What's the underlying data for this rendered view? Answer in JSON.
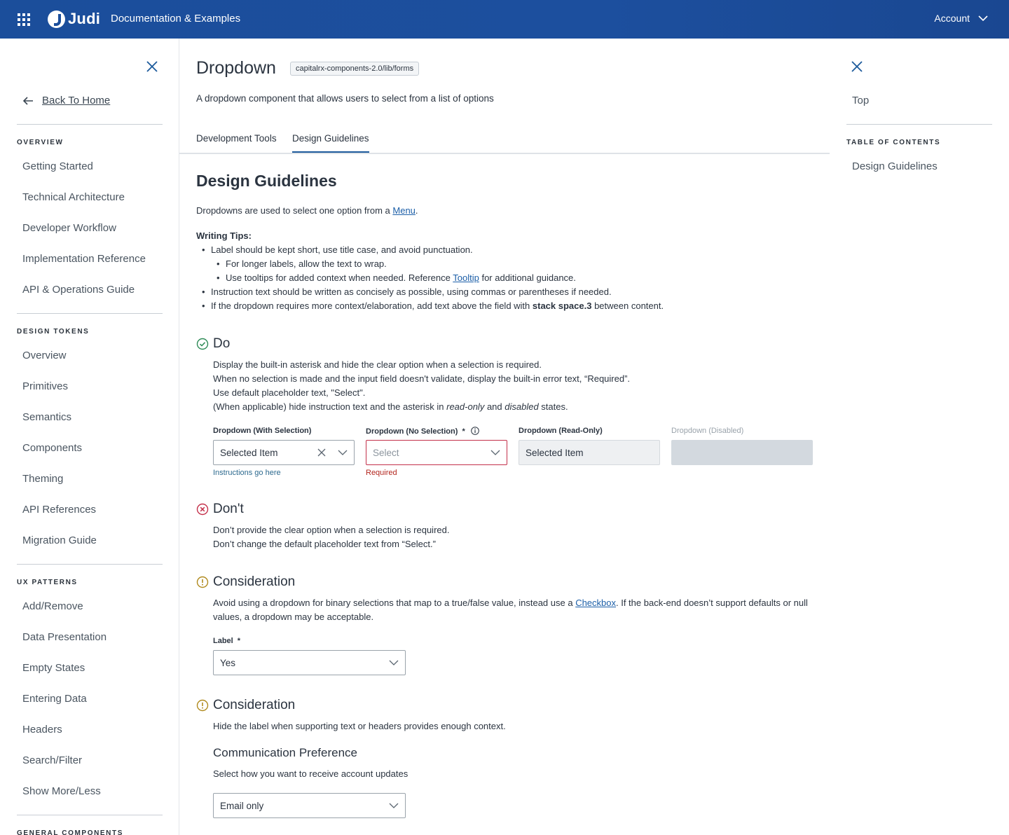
{
  "topbar": {
    "logo_text": "Judi",
    "title": "Documentation & Examples",
    "account_label": "Account"
  },
  "sidebar": {
    "back_label": "Back To Home",
    "sections": [
      {
        "heading": "OVERVIEW",
        "items": [
          "Getting Started",
          "Technical Architecture",
          "Developer Workflow",
          "Implementation Reference",
          "API & Operations Guide"
        ]
      },
      {
        "heading": "DESIGN TOKENS",
        "items": [
          "Overview",
          "Primitives",
          "Semantics",
          "Components",
          "Theming",
          "API References",
          "Migration Guide"
        ]
      },
      {
        "heading": "UX PATTERNS",
        "items": [
          "Add/Remove",
          "Data Presentation",
          "Empty States",
          "Entering Data",
          "Headers",
          "Search/Filter",
          "Show More/Less"
        ]
      },
      {
        "heading": "GENERAL COMPONENTS",
        "items": []
      }
    ]
  },
  "main": {
    "title": "Dropdown",
    "path_badge": "capitalrx-components-2.0/lib/forms",
    "description": "A dropdown component that allows users to select from a list of options",
    "tabs": [
      {
        "label": "Development Tools",
        "active": false
      },
      {
        "label": "Design Guidelines",
        "active": true
      }
    ],
    "section_heading": "Design Guidelines",
    "intro_prefix": "Dropdowns are used to select one option from a ",
    "intro_link": "Menu",
    "intro_suffix": ".",
    "writing_tips_label": "Writing Tips:",
    "tips": {
      "t1": "Label should be kept short, use title case, and avoid punctuation.",
      "t1a": "For longer labels, allow the text to wrap.",
      "t1b_prefix": "Use tooltips for added context when needed. Reference ",
      "t1b_link": "Tooltip",
      "t1b_suffix": " for additional guidance.",
      "t2": "Instruction text should be written as concisely as possible, using commas or parentheses if needed.",
      "t3_prefix": "If the dropdown requires more context/elaboration, add text above the field with ",
      "t3_bold": "stack space.3",
      "t3_suffix": " between content."
    },
    "do": {
      "title": "Do",
      "line1": "Display the built-in asterisk and hide the clear option when a selection is required.",
      "line2": "When no selection is made and the input field doesn't validate, display the built-in error text, “Required”.",
      "line3": "Use default placeholder text, \"Select\".",
      "line4_prefix": "(When applicable) hide instruction text and the asterisk in ",
      "line4_em1": "read-only",
      "line4_mid": " and ",
      "line4_em2": "disabled",
      "line4_suffix": " states.",
      "examples": {
        "with_selection": {
          "label": "Dropdown (With Selection)",
          "value": "Selected Item",
          "helper": "Instructions go here"
        },
        "no_selection": {
          "label": "Dropdown  (No Selection)",
          "required_mark": "*",
          "placeholder": "Select",
          "error": "Required"
        },
        "read_only": {
          "label": "Dropdown (Read-Only)",
          "value": "Selected Item"
        },
        "disabled": {
          "label": "Dropdown (Disabled)"
        }
      }
    },
    "dont": {
      "title": "Don't",
      "line1": "Don’t provide the clear option when a selection is required.",
      "line2": "Don’t change the default placeholder text from “Select.”"
    },
    "consideration1": {
      "title": "Consideration",
      "text_prefix": "Avoid using a dropdown for binary selections that map to a true/false value, instead use a ",
      "text_link": "Checkbox",
      "text_suffix": ". If the back-end doesn’t support defaults or null values, a dropdown may be acceptable.",
      "field_label": "Label",
      "required_mark": "*",
      "field_value": "Yes"
    },
    "consideration2": {
      "title": "Consideration",
      "text": "Hide the label when supporting text or headers provides enough context.",
      "example_heading": "Communication Preference",
      "example_desc": "Select how you want to receive account updates",
      "field_value": "Email only"
    }
  },
  "toc": {
    "top_label": "Top",
    "heading": "TABLE OF CONTENTS",
    "items": [
      "Design Guidelines"
    ]
  },
  "colors": {
    "topbar": "#1b4e9b",
    "accent": "#1c5a9b",
    "success": "#2e8b57",
    "error": "#c4314b",
    "warning": "#b08a1e"
  }
}
